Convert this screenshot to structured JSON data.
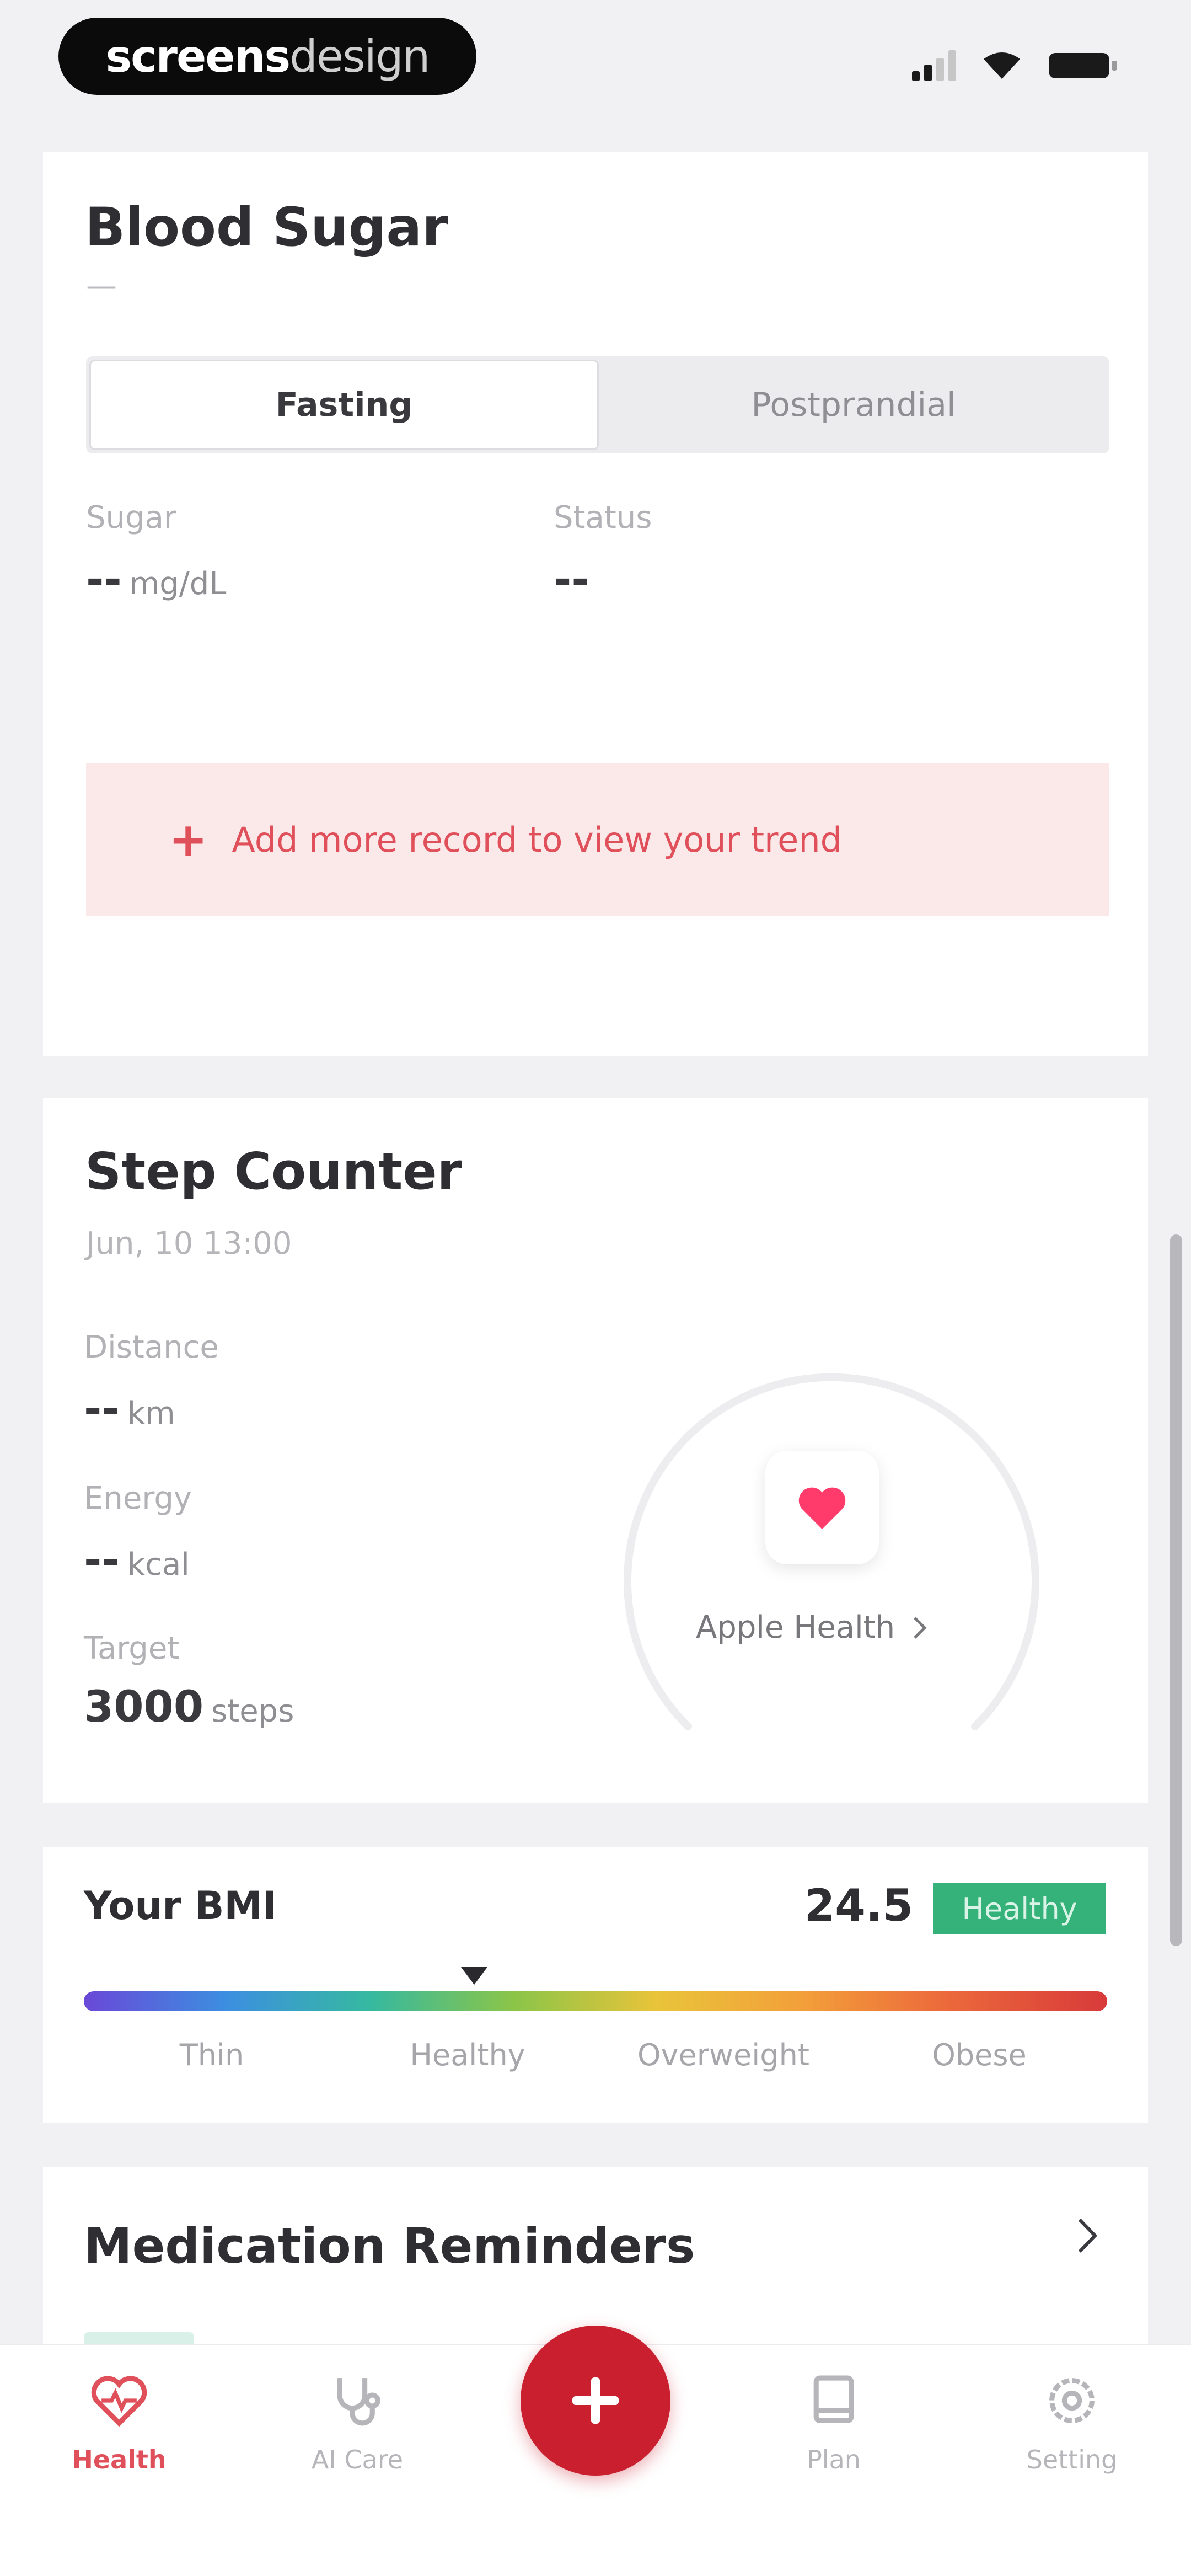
{
  "status_bar": {
    "watermark_bold": "screens",
    "watermark_light": "design"
  },
  "blood_sugar": {
    "title": "Blood Sugar",
    "subtitle": "—",
    "tabs": [
      "Fasting",
      "Postprandial"
    ],
    "selected_tab": "Fasting",
    "sugar_label": "Sugar",
    "sugar_value": "--",
    "sugar_unit": "mg/dL",
    "status_label": "Status",
    "status_value": "--",
    "add_record_text": "Add more record to view your trend",
    "add_record_color": "#e0505a"
  },
  "step_counter": {
    "title": "Step Counter",
    "date": "Jun, 10 13:00",
    "distance_label": "Distance",
    "distance_value": "--",
    "distance_unit": "km",
    "energy_label": "Energy",
    "energy_value": "--",
    "energy_unit": "kcal",
    "target_label": "Target",
    "target_value": "3000",
    "target_unit": "steps",
    "source_label": "Apple Health",
    "source_icon": "heart-icon"
  },
  "bmi": {
    "title": "Your BMI",
    "value": "24.5",
    "badge": "Healthy",
    "badge_color": "#34b27a",
    "categories": [
      "Thin",
      "Healthy",
      "Overweight",
      "Obese"
    ]
  },
  "medication": {
    "title": "Medication Reminders"
  },
  "tab_bar": {
    "tabs": [
      {
        "label": "Health",
        "icon": "heart-pulse-icon",
        "active": true
      },
      {
        "label": "AI Care",
        "icon": "stethoscope-icon",
        "active": false
      },
      {
        "label": "Plan",
        "icon": "book-icon",
        "active": false
      },
      {
        "label": "Setting",
        "icon": "gear-icon",
        "active": false
      }
    ],
    "fab_icon": "plus-icon",
    "accent_color": "#c91f2e"
  }
}
